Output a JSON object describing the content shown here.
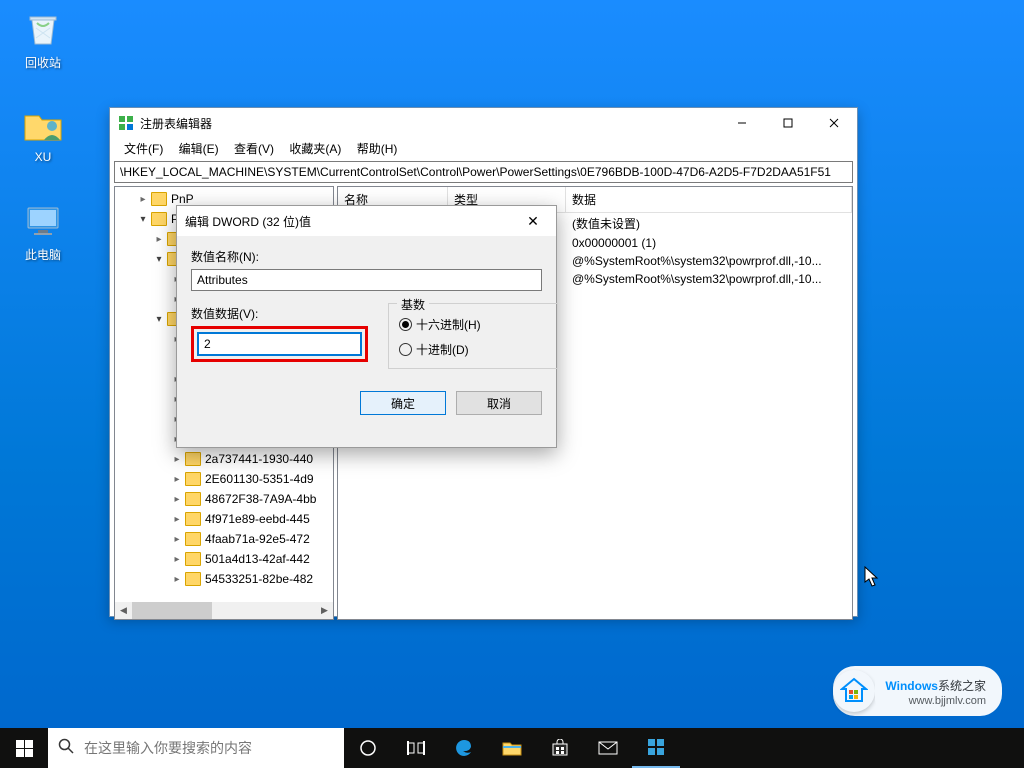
{
  "desktop": {
    "recycle": "回收站",
    "user_folder": "XU",
    "this_pc": "此电脑"
  },
  "regedit": {
    "title": "注册表编辑器",
    "menus": [
      "文件(F)",
      "编辑(E)",
      "查看(V)",
      "收藏夹(A)",
      "帮助(H)"
    ],
    "path": "\\HKEY_LOCAL_MACHINE\\SYSTEM\\CurrentControlSet\\Control\\Power\\PowerSettings\\0E796BDB-100D-47D6-A2D5-F7D2DAA51F51",
    "tree_pnp": "PnP",
    "tree_po": "Po",
    "tree_items": [
      "2a737441-1930-440",
      "2E601130-5351-4d9",
      "48672F38-7A9A-4bb",
      "4f971e89-eebd-445",
      "4faab71a-92e5-472",
      "501a4d13-42af-442",
      "54533251-82be-482"
    ],
    "list_headers": {
      "name": "名称",
      "type": "类型",
      "data": "数据"
    },
    "list_rows": [
      "(数值未设置)",
      "0x00000001 (1)",
      "@%SystemRoot%\\system32\\powrprof.dll,-10...",
      "@%SystemRoot%\\system32\\powrprof.dll,-10..."
    ]
  },
  "dword": {
    "title": "编辑 DWORD (32 位)值",
    "name_label": "数值名称(N):",
    "name_value": "Attributes",
    "data_label": "数值数据(V):",
    "data_value": "2",
    "base_label": "基数",
    "base_hex": "十六进制(H)",
    "base_dec": "十进制(D)",
    "ok": "确定",
    "cancel": "取消"
  },
  "taskbar": {
    "search_placeholder": "在这里输入你要搜索的内容"
  },
  "watermark": {
    "brand_a": "Windows",
    "brand_b": "系统之家",
    "url": "www.bjjmlv.com"
  }
}
